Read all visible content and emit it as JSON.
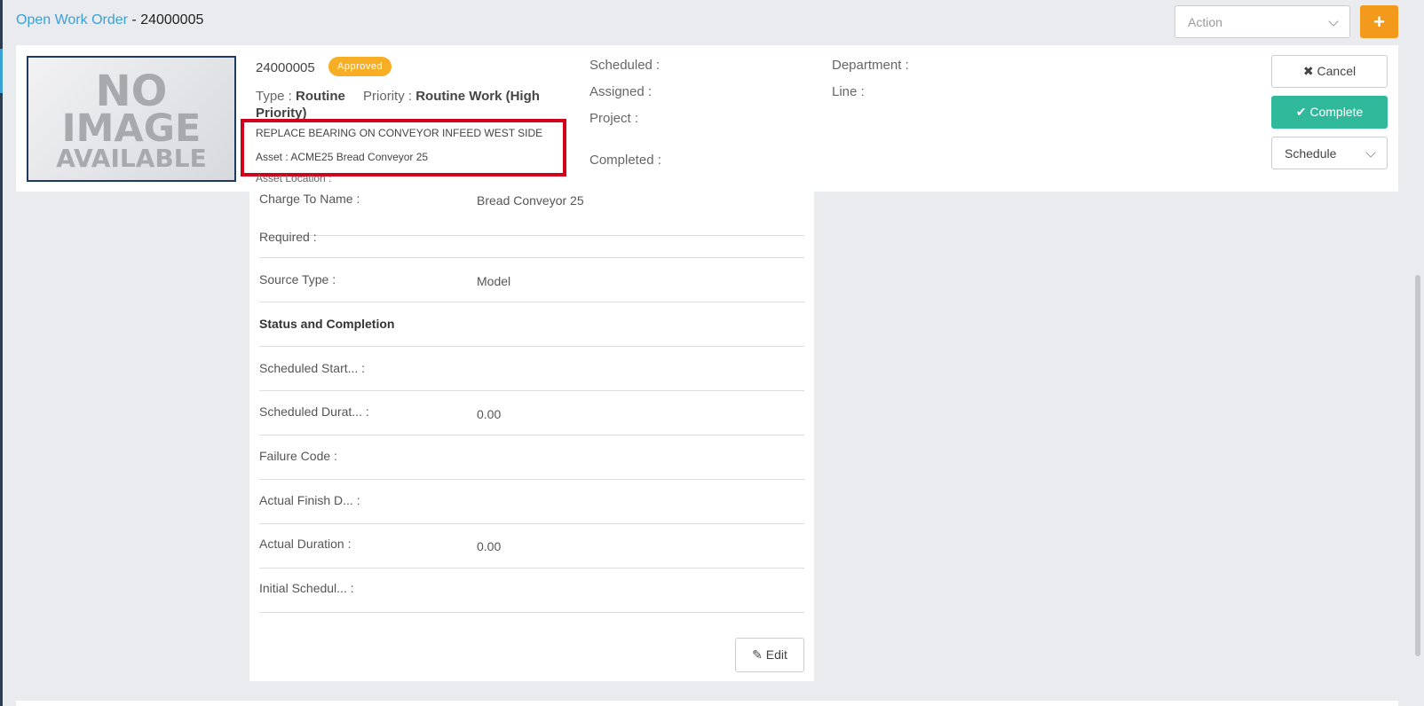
{
  "header": {
    "link": "Open Work Order",
    "separator": " - ",
    "number": "24000005",
    "action_placeholder": "Action",
    "plus_label": "+"
  },
  "work_order": {
    "number": "24000005",
    "status": "Approved",
    "type_label": "Type :",
    "type_value": "Routine",
    "priority_label": "Priority :",
    "priority_value": "Routine Work (High Priority)",
    "description": "REPLACE BEARING ON CONVEYOR INFEED WEST SIDE",
    "asset": "Asset : ACME25 Bread Conveyor 25",
    "asset_location": "Asset Location :",
    "scheduled": "Scheduled :",
    "assigned": "Assigned :",
    "project": "Project :",
    "completed": "Completed :",
    "department": "Department :",
    "line": "Line :"
  },
  "image": {
    "l1": "NO",
    "l2": "IMAGE",
    "l3": "AVAILABLE"
  },
  "buttons": {
    "cancel": "Cancel",
    "complete": "Complete",
    "schedule": "Schedule",
    "edit": "Edit"
  },
  "details": [
    {
      "label": "Charge To Name :",
      "value": "Bread Conveyor 25"
    },
    {
      "label": "Required :",
      "value": ""
    },
    {
      "label": "Source Type :",
      "value": "Model"
    },
    {
      "label": "Status and Completion",
      "value": "",
      "section": true
    },
    {
      "label": "Scheduled Start... :",
      "value": ""
    },
    {
      "label": "Scheduled Durat... :",
      "value": "0.00"
    },
    {
      "label": "Failure Code :",
      "value": ""
    },
    {
      "label": "Actual Finish D... :",
      "value": ""
    },
    {
      "label": "Actual Duration :",
      "value": "0.00"
    },
    {
      "label": "Initial Schedul... :",
      "value": ""
    }
  ],
  "colors": {
    "accent": "#3aa0d8",
    "approved": "#f7ae24",
    "complete": "#2fb99a",
    "plus": "#f39a1c",
    "highlight": "#d0021b"
  },
  "icons": {
    "cancel": "times-icon",
    "complete": "check-icon",
    "edit": "pencil-icon",
    "chevron": "chevron-down-icon"
  }
}
